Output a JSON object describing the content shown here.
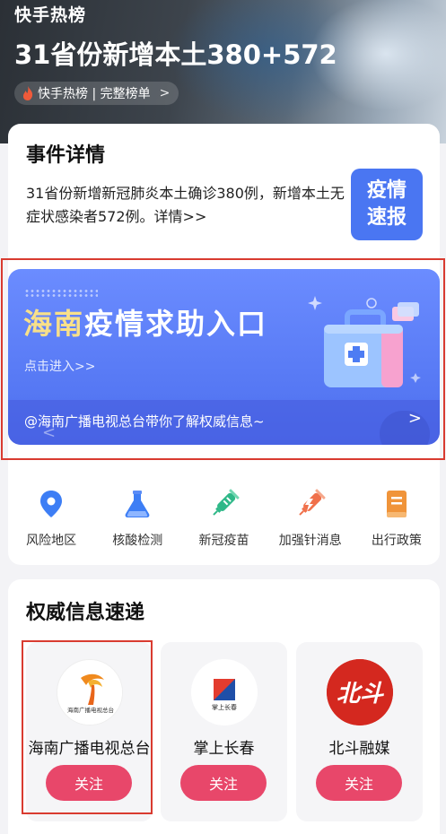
{
  "hero": {
    "source_title": "快手热榜",
    "headline": "31省份新增本土380+572",
    "chip_label": "快手热榜 | 完整榜单",
    "chip_arrow": ">"
  },
  "event": {
    "title": "事件详情",
    "description": "31省份新增新冠肺炎本土确诊380例，新增本土无症状感染者572例。详情>>",
    "button_line1": "疫情",
    "button_line2": "速报"
  },
  "banner": {
    "title_part1": "海南",
    "title_part2": "疫情求助入口",
    "subtitle": "点击进入>>",
    "footer_text": "@海南广播电视总台带你了解权威信息~",
    "footer_arrow": ">",
    "carousel_left": "<"
  },
  "quick_nav": [
    {
      "label": "风险地区",
      "icon": "location-pin-icon",
      "color": "#3d7ef5"
    },
    {
      "label": "核酸检测",
      "icon": "flask-icon",
      "color": "#3d7ef5"
    },
    {
      "label": "新冠疫苗",
      "icon": "syringe-icon",
      "color": "#2fb888"
    },
    {
      "label": "加强针消息",
      "icon": "booster-syringe-icon",
      "color": "#f0704a"
    },
    {
      "label": "出行政策",
      "icon": "document-icon",
      "color": "#f0943a"
    }
  ],
  "authority": {
    "title": "权威信息速递",
    "media": [
      {
        "name": "海南广播电视总台",
        "follow": "关注",
        "logo_text": "海南广播电视总台"
      },
      {
        "name": "掌上长春",
        "follow": "关注",
        "logo_text": "掌上长春"
      },
      {
        "name": "北斗融媒",
        "follow": "关注",
        "logo_text": "北斗"
      }
    ]
  },
  "colors": {
    "accent_blue": "#4a76f2",
    "follow_pink": "#e8476a",
    "highlight_red": "#d93b30"
  }
}
